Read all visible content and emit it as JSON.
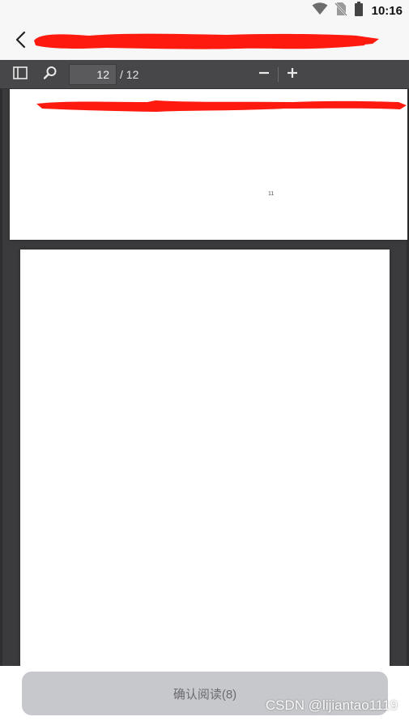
{
  "status_bar": {
    "time": "10:16",
    "icons": [
      "wifi-icon",
      "no-sim-icon",
      "battery-icon"
    ]
  },
  "header": {
    "back_icon": "back-arrow-icon",
    "title": ""
  },
  "pdf_toolbar": {
    "sidebar_icon": "sidebar-toggle-icon",
    "search_icon": "search-icon",
    "current_page": "12",
    "total_pages": "/ 12",
    "zoom_out_icon": "minus-icon",
    "zoom_in_icon": "plus-icon"
  },
  "viewer": {
    "page_footer_number": "11"
  },
  "footer": {
    "confirm_label": "确认阅读(8)"
  },
  "watermark": "CSDN @lijiantao1119",
  "colors": {
    "toolbar": "#474749",
    "viewer_bg": "#3b3b3d",
    "redaction": "#ff1a0f",
    "button_disabled": "#c7c8cc"
  }
}
